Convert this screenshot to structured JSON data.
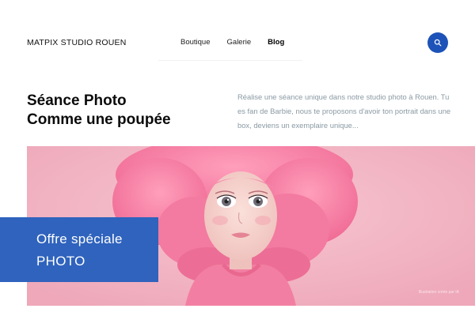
{
  "header": {
    "brand": "MATPIX STUDIO ROUEN",
    "nav": [
      {
        "label": "Boutique",
        "active": false
      },
      {
        "label": "Galerie",
        "active": false
      },
      {
        "label": "Blog",
        "active": true
      }
    ],
    "search_icon": "search-icon",
    "accent_color": "#1d53b8"
  },
  "hero": {
    "title_line1": "Séance Photo",
    "title_line2": "Comme une poupée",
    "description": "Réalise une séance unique dans notre studio photo à Rouen. Tu es fan de Barbie, nous te proposons d'avoir ton portrait dans une box, deviens un exemplaire unique..."
  },
  "banner": {
    "caption": "Illustration créée par IA",
    "background_color": "#f2b6c4"
  },
  "offer": {
    "line1": "Offre spéciale",
    "line2": "PHOTO",
    "color": "#2f63bd"
  }
}
